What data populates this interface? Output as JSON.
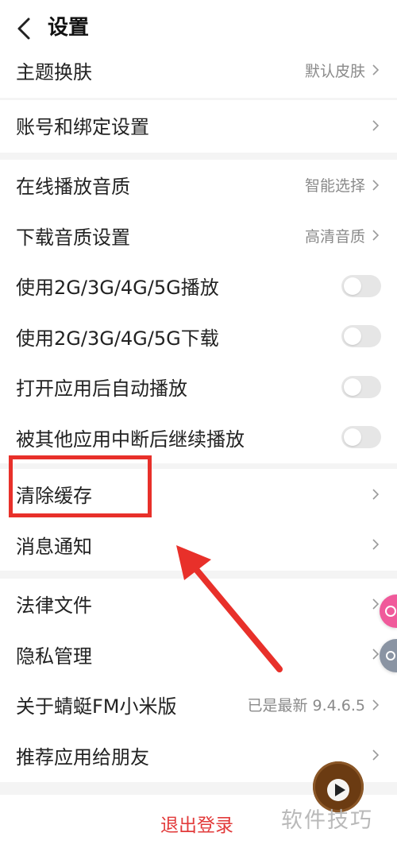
{
  "header": {
    "title": "设置",
    "back_icon": "chevron-left-icon"
  },
  "sections": {
    "theme": {
      "label": "主题换肤",
      "value": "默认皮肤"
    },
    "account": {
      "label": "账号和绑定设置"
    },
    "playback": {
      "online_quality": {
        "label": "在线播放音质",
        "value": "智能选择"
      },
      "download_quality": {
        "label": "下载音质设置",
        "value": "高清音质"
      },
      "mobile_play": {
        "label": "使用2G/3G/4G/5G播放",
        "enabled": false
      },
      "mobile_download": {
        "label": "使用2G/3G/4G/5G下载",
        "enabled": false
      },
      "autoplay": {
        "label": "打开应用后自动播放",
        "enabled": false
      },
      "resume": {
        "label": "被其他应用中断后继续播放",
        "enabled": false
      }
    },
    "misc": {
      "clear_cache": {
        "label": "清除缓存"
      },
      "notifications": {
        "label": "消息通知"
      }
    },
    "about": {
      "legal": {
        "label": "法律文件"
      },
      "privacy": {
        "label": "隐私管理"
      },
      "version": {
        "label": "关于蜻蜓FM小米版",
        "value": "已是最新 9.4.6.5"
      },
      "recommend": {
        "label": "推荐应用给朋友"
      }
    }
  },
  "logout": {
    "label": "退出登录"
  },
  "watermark": "软件技巧",
  "colors": {
    "accent_red": "#e23b3b",
    "annotation_red": "#e8302a",
    "toggle_off": "#e6e6e6"
  }
}
